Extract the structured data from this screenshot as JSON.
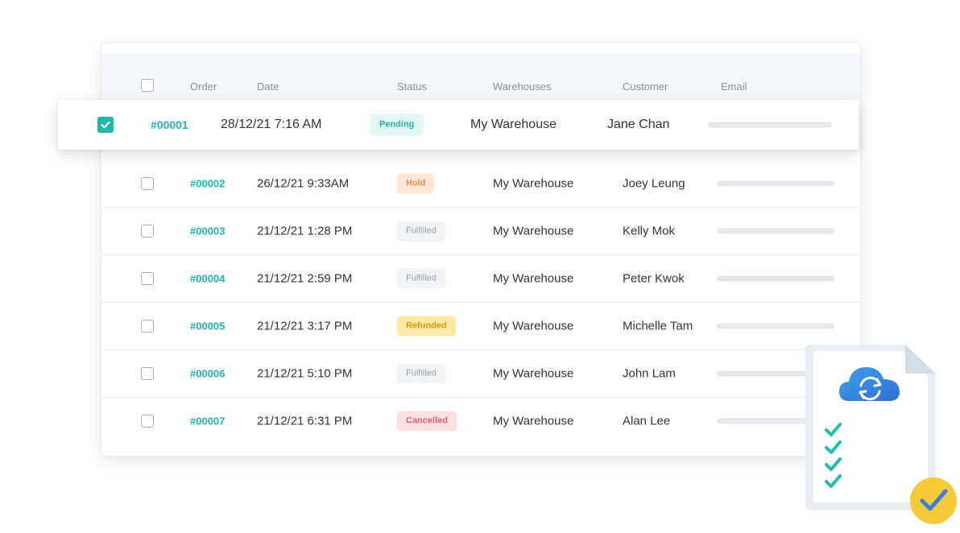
{
  "table": {
    "headers": {
      "order": "Order",
      "date": "Date",
      "status": "Status",
      "warehouses": "Warehouses",
      "customer": "Customer",
      "email": "Email"
    },
    "selected_row": {
      "order": "#00001",
      "date": "28/12/21 7:16 AM",
      "status": "Pending",
      "status_type": "pending",
      "warehouse": "My Warehouse",
      "customer": "Jane Chan",
      "checked": true
    },
    "rows": [
      {
        "order": "#00002",
        "date": "26/12/21 9:33AM",
        "status": "Hold",
        "status_type": "hold",
        "warehouse": "My Warehouse",
        "customer": "Joey Leung"
      },
      {
        "order": "#00003",
        "date": "21/12/21 1:28 PM",
        "status": "Fulfilled",
        "status_type": "fulfilled",
        "warehouse": "My Warehouse",
        "customer": "Kelly Mok"
      },
      {
        "order": "#00004",
        "date": "21/12/21 2:59 PM",
        "status": "Fulfilled",
        "status_type": "fulfilled",
        "warehouse": "My Warehouse",
        "customer": "Peter Kwok"
      },
      {
        "order": "#00005",
        "date": "21/12/21 3:17 PM",
        "status": "Refunded",
        "status_type": "refunded",
        "warehouse": "My Warehouse",
        "customer": "Michelle Tam"
      },
      {
        "order": "#00006",
        "date": "21/12/21 5:10 PM",
        "status": "Fulfilled",
        "status_type": "fulfilled",
        "warehouse": "My Warehouse",
        "customer": "John Lam"
      },
      {
        "order": "#00007",
        "date": "21/12/21 6:31 PM",
        "status": "Cancelled",
        "status_type": "cancelled",
        "warehouse": "My Warehouse",
        "customer": "Alan Lee"
      }
    ]
  },
  "colors": {
    "accent": "#1fb8a8",
    "pending": "#22b3a3",
    "hold": "#e48a55",
    "refunded": "#d29a10",
    "cancelled": "#d46666",
    "cloud": "#3a8fe0",
    "badge_check": "#f6c936"
  },
  "icons": [
    "checkbox-icon",
    "checkmark-icon",
    "cloud-sync-icon",
    "document-icon",
    "check-badge-icon"
  ]
}
